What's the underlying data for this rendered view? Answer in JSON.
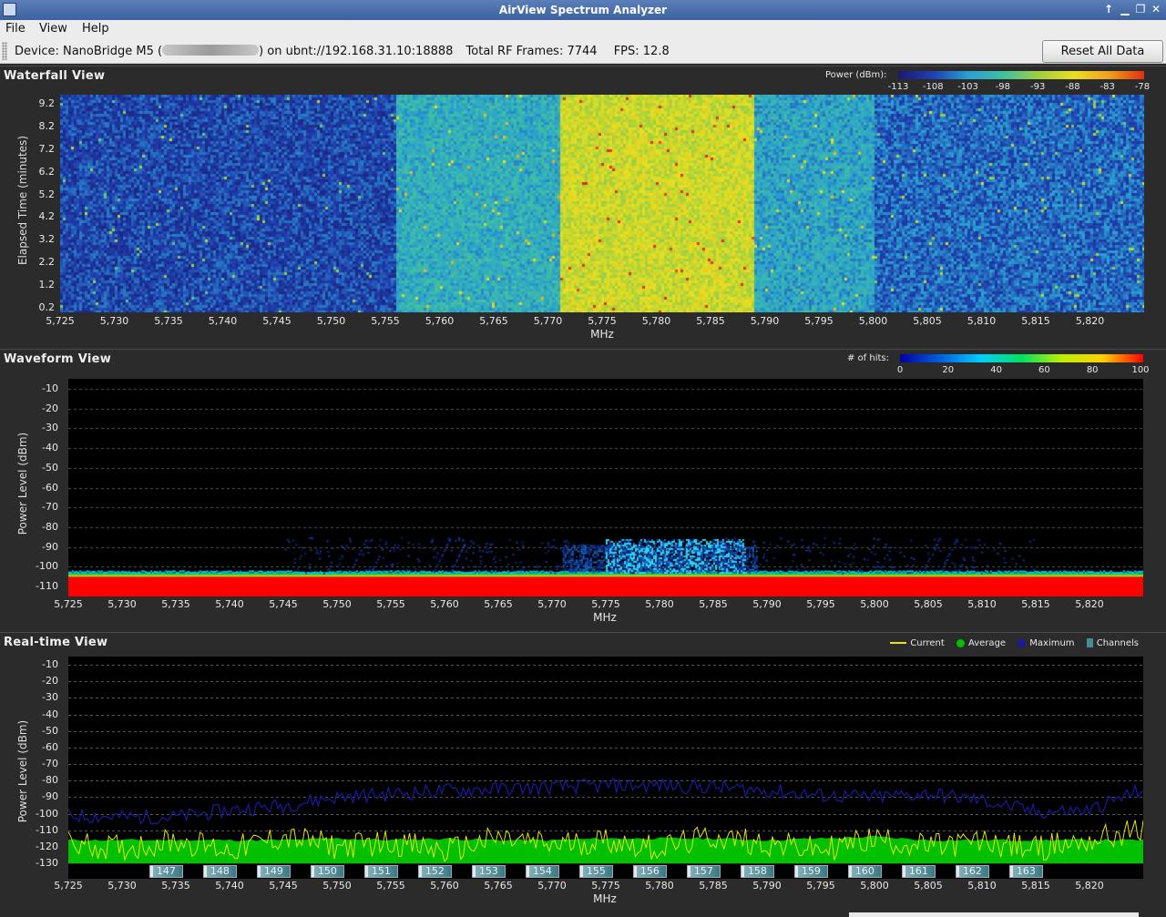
{
  "window": {
    "title": "AirView Spectrum Analyzer"
  },
  "menu": {
    "file": "File",
    "view": "View",
    "help": "Help"
  },
  "toolbar": {
    "device_prefix": "Device: NanoBridge M5 (",
    "device_suffix": ") on ubnt://192.168.31.10:18888",
    "frames_label": "Total RF Frames: 7744",
    "fps_label": "FPS: 12.8",
    "reset_label": "Reset All Data"
  },
  "waterfall": {
    "title": "Waterfall View",
    "ylabel": "Elapsed Time (minutes)",
    "xlabel": "MHz",
    "legend_title": "Power (dBm):",
    "legend_ticks": [
      "-113",
      "-108",
      "-103",
      "-98",
      "-93",
      "-88",
      "-83",
      "-78"
    ],
    "y_ticks": [
      "9.2",
      "8.2",
      "7.2",
      "6.2",
      "5.2",
      "4.2",
      "3.2",
      "2.2",
      "1.2",
      "0.2"
    ]
  },
  "waveform": {
    "title": "Waveform View",
    "ylabel": "Power Level (dBm)",
    "xlabel": "MHz",
    "legend_title": "# of hits:",
    "legend_ticks": [
      "0",
      "20",
      "40",
      "60",
      "80",
      "100"
    ],
    "y_ticks": [
      "-10",
      "-20",
      "-30",
      "-40",
      "-50",
      "-60",
      "-70",
      "-80",
      "-90",
      "-100",
      "-110"
    ]
  },
  "realtime": {
    "title": "Real-time View",
    "ylabel": "Power Level (dBm)",
    "xlabel": "MHz",
    "legend": [
      "Current",
      "Average",
      "Maximum",
      "Channels"
    ],
    "y_ticks": [
      "-10",
      "-20",
      "-30",
      "-40",
      "-50",
      "-60",
      "-70",
      "-80",
      "-90",
      "-100",
      "-110",
      "-120",
      "-130"
    ],
    "channels": [
      "147",
      "148",
      "149",
      "150",
      "151",
      "152",
      "153",
      "154",
      "155",
      "156",
      "157",
      "158",
      "159",
      "160",
      "161",
      "162",
      "163"
    ]
  },
  "x_ticks": [
    "5,725",
    "5,730",
    "5,735",
    "5,740",
    "5,745",
    "5,750",
    "5,755",
    "5,760",
    "5,765",
    "5,770",
    "5,775",
    "5,780",
    "5,785",
    "5,790",
    "5,795",
    "5,800",
    "5,805",
    "5,810",
    "5,815",
    "5,820"
  ],
  "colors": {
    "current": "#e6e600",
    "average": "#00c000",
    "maximum": "#1a1aa0",
    "channels": "#4a8a92",
    "waveform_floor": "#ff0000"
  },
  "chart_data": [
    {
      "type": "heatmap",
      "title": "Waterfall View",
      "xlabel": "MHz",
      "ylabel": "Elapsed Time (minutes)",
      "xlim": [
        5725,
        5825
      ],
      "ylim": [
        0,
        9.6
      ],
      "colorbar": {
        "label": "Power (dBm):",
        "range": [
          -113,
          -78
        ]
      },
      "bands": [
        {
          "x": [
            5771,
            5789
          ],
          "power_dbm": -90
        },
        {
          "x": [
            5756,
            5771
          ],
          "power_dbm": -101
        },
        {
          "x": [
            5789,
            5800
          ],
          "power_dbm": -102
        },
        {
          "x": [
            5725,
            5756
          ],
          "power_dbm": -108
        },
        {
          "x": [
            5800,
            5825
          ],
          "power_dbm": -106
        }
      ]
    },
    {
      "type": "heatmap",
      "title": "Waveform View",
      "xlabel": "MHz",
      "ylabel": "Power Level (dBm)",
      "xlim": [
        5725,
        5825
      ],
      "ylim": [
        -115,
        -5
      ],
      "colorbar": {
        "label": "# of hits:",
        "range": [
          0,
          100
        ]
      },
      "noise_floor_dbm": -105,
      "elevated": [
        {
          "x": [
            5771,
            5789
          ],
          "level_dbm": -89
        },
        {
          "x": [
            5775,
            5788
          ],
          "level_dbm": -86
        }
      ]
    },
    {
      "type": "line",
      "title": "Real-time View",
      "xlabel": "MHz",
      "ylabel": "Power Level (dBm)",
      "xlim": [
        5725,
        5825
      ],
      "ylim": [
        -130,
        -5
      ],
      "x": [
        5725,
        5730,
        5735,
        5740,
        5745,
        5750,
        5755,
        5760,
        5765,
        5770,
        5775,
        5780,
        5785,
        5790,
        5795,
        5800,
        5805,
        5810,
        5815,
        5820,
        5825
      ],
      "series": [
        {
          "name": "Maximum",
          "values": [
            -101,
            -102,
            -102,
            -98,
            -95,
            -90,
            -88,
            -86,
            -85,
            -84,
            -83,
            -83,
            -84,
            -86,
            -89,
            -90,
            -88,
            -92,
            -99,
            -98,
            -85
          ]
        },
        {
          "name": "Current",
          "values": [
            -118,
            -121,
            -116,
            -122,
            -114,
            -120,
            -117,
            -123,
            -115,
            -119,
            -116,
            -121,
            -114,
            -118,
            -122,
            -115,
            -120,
            -117,
            -121,
            -116,
            -110
          ]
        },
        {
          "name": "Average",
          "values": [
            -116,
            -116,
            -116,
            -116,
            -116,
            -115,
            -116,
            -115,
            -116,
            -116,
            -115,
            -115,
            -115,
            -116,
            -115,
            -114,
            -116,
            -116,
            -116,
            -116,
            -116
          ]
        }
      ],
      "channels": [
        {
          "name": "147",
          "center": 5735
        },
        {
          "name": "148",
          "center": 5740
        },
        {
          "name": "149",
          "center": 5745
        },
        {
          "name": "150",
          "center": 5750
        },
        {
          "name": "151",
          "center": 5755
        },
        {
          "name": "152",
          "center": 5760
        },
        {
          "name": "153",
          "center": 5765
        },
        {
          "name": "154",
          "center": 5770
        },
        {
          "name": "155",
          "center": 5775
        },
        {
          "name": "156",
          "center": 5780
        },
        {
          "name": "157",
          "center": 5785
        },
        {
          "name": "158",
          "center": 5790
        },
        {
          "name": "159",
          "center": 5795
        },
        {
          "name": "160",
          "center": 5800
        },
        {
          "name": "161",
          "center": 5805
        },
        {
          "name": "162",
          "center": 5810
        },
        {
          "name": "163",
          "center": 5815
        }
      ]
    }
  ]
}
